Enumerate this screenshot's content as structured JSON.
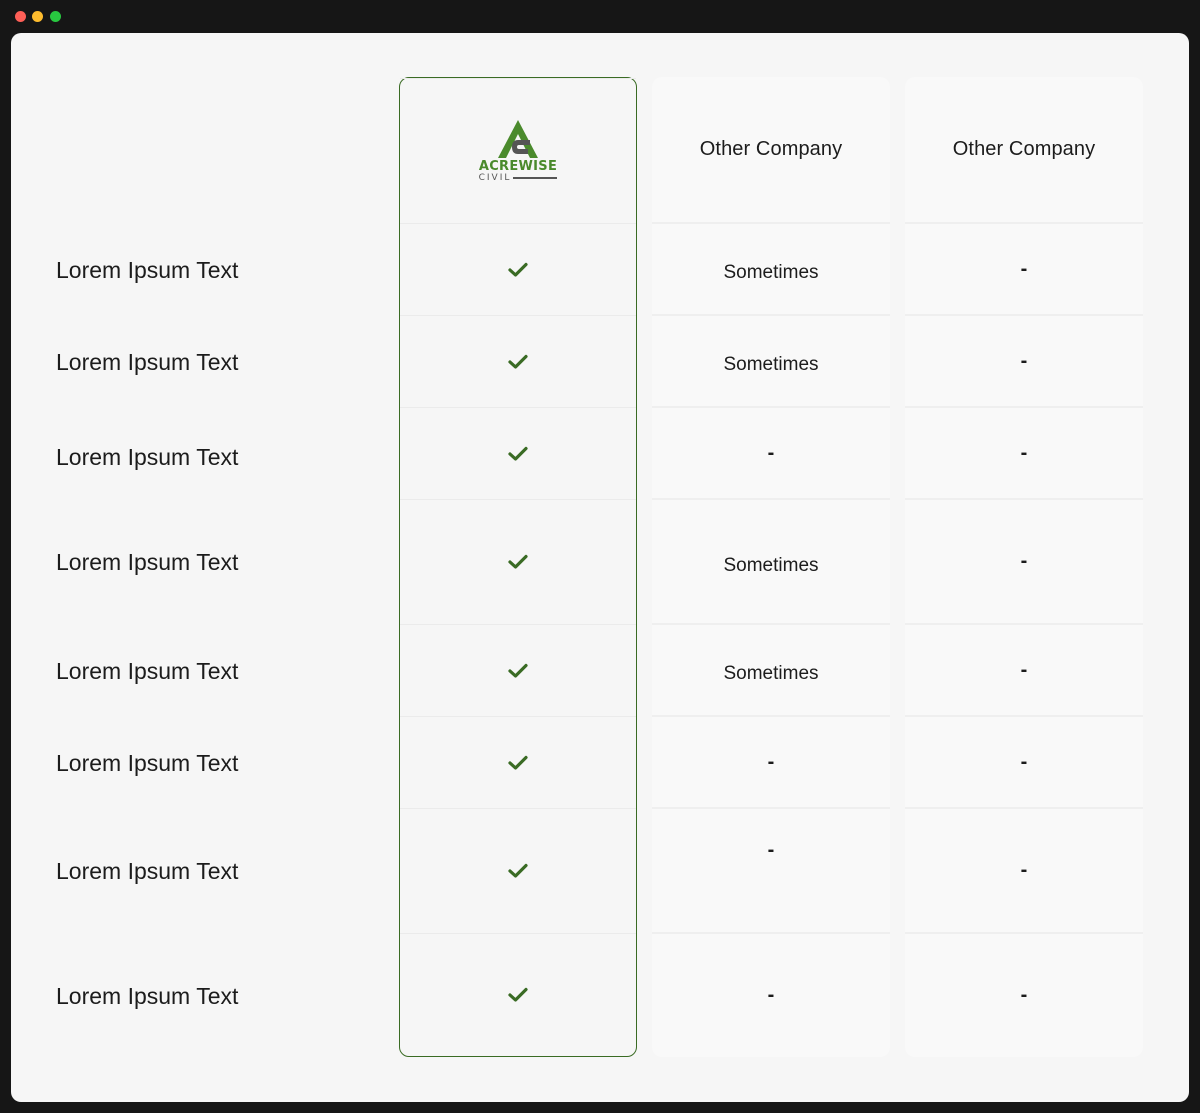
{
  "window": {
    "controls": [
      "close",
      "minimize",
      "maximize"
    ]
  },
  "colors": {
    "accent": "#3a6b24",
    "logo_green": "#4a8a2c",
    "window_bg": "#f6f6f6",
    "frame_bg": "#161616"
  },
  "brand": {
    "logo_primary": "ACREWISE",
    "logo_secondary": "CIVIL",
    "logo_icon": "acrewise-logo-icon"
  },
  "columns": {
    "other1_header": "Other Company",
    "other2_header": "Other Company"
  },
  "rows": [
    {
      "label": "Lorem Ipsum Text",
      "brand": "check",
      "other1": "Sometimes",
      "other2": "-"
    },
    {
      "label": "Lorem Ipsum Text",
      "brand": "check",
      "other1": "Sometimes",
      "other2": "-"
    },
    {
      "label": "Lorem Ipsum Text",
      "brand": "check",
      "other1": "-",
      "other2": "-"
    },
    {
      "label": "Lorem Ipsum Text",
      "brand": "check",
      "other1": "Sometimes",
      "other2": "-"
    },
    {
      "label": "Lorem Ipsum Text",
      "brand": "check",
      "other1": "Sometimes",
      "other2": "-"
    },
    {
      "label": "Lorem Ipsum Text",
      "brand": "check",
      "other1": "-",
      "other2": "-"
    },
    {
      "label": "Lorem Ipsum Text",
      "brand": "check",
      "other1": "-",
      "other2": "-"
    },
    {
      "label": "Lorem Ipsum Text",
      "brand": "check",
      "other1": "-",
      "other2": "-"
    }
  ]
}
